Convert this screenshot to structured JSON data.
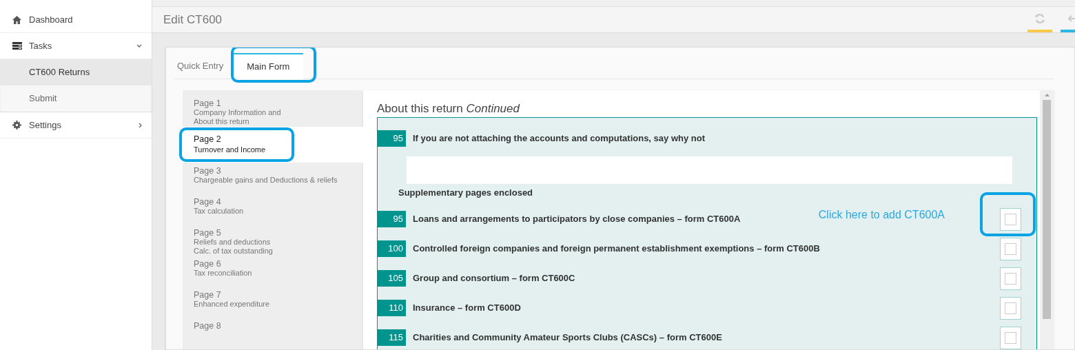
{
  "sidebar": {
    "items": [
      {
        "kind": "link",
        "label": "Dashboard"
      },
      {
        "kind": "group",
        "label": "Tasks",
        "expanded": true,
        "children": [
          {
            "label": "CT600 Returns",
            "selected": true
          },
          {
            "label": "Submit",
            "selected": false
          }
        ]
      },
      {
        "kind": "group",
        "label": "Settings",
        "expanded": false
      }
    ]
  },
  "header": {
    "title": "Edit CT600"
  },
  "tabs": [
    {
      "label": "Quick Entry",
      "selected": false,
      "highlighted": false
    },
    {
      "label": "Main Form",
      "selected": true,
      "highlighted": true
    }
  ],
  "pages": [
    {
      "title": "Page 1",
      "subtitle": [
        "Company Information and",
        "About this return"
      ],
      "selected": false,
      "highlighted": false
    },
    {
      "title": "Page 2",
      "subtitle": [
        "Turnover and Income"
      ],
      "selected": true,
      "highlighted": true
    },
    {
      "title": "Page 3",
      "subtitle": [
        "Chargeable gains and Deductions & reliefs"
      ],
      "selected": false,
      "highlighted": false
    },
    {
      "title": "Page 4",
      "subtitle": [
        "Tax calculation"
      ],
      "selected": false,
      "highlighted": false
    },
    {
      "title": "Page 5",
      "subtitle": [
        "Reliefs and deductions",
        "Calc. of tax outstanding"
      ],
      "selected": false,
      "highlighted": false
    },
    {
      "title": "Page 6",
      "subtitle": [
        "Tax reconciliation"
      ],
      "selected": false,
      "highlighted": false
    },
    {
      "title": "Page 7",
      "subtitle": [
        "Enhanced expenditure"
      ],
      "selected": false,
      "highlighted": false
    },
    {
      "title": "Page 8",
      "selected": false,
      "highlighted": false
    }
  ],
  "section": {
    "title": "About this return *Continued*",
    "question": {
      "number": "95",
      "label": "If you are not attaching the accounts and computations, say why not"
    },
    "supplementary_heading": "Supplementary pages enclosed",
    "rows": [
      {
        "number": "95",
        "label": "Loans and arrangements to participators by close companies – form CT600A",
        "checked": false,
        "hint": "Click here to add CT600A",
        "highlighted": true
      },
      {
        "number": "100",
        "label": "Controlled foreign companies and foreign permanent establishment exemptions – form CT600B",
        "checked": false,
        "highlighted": false
      },
      {
        "number": "105",
        "label": "Group and consortium – form CT600C",
        "checked": false,
        "highlighted": false
      },
      {
        "number": "110",
        "label": "Insurance – form CT600D",
        "checked": false,
        "highlighted": false
      },
      {
        "number": "115",
        "label": "Charities and Community Amateur Sports Clubs (CASCs) – form CT600E",
        "checked": false,
        "highlighted": false
      }
    ]
  }
}
